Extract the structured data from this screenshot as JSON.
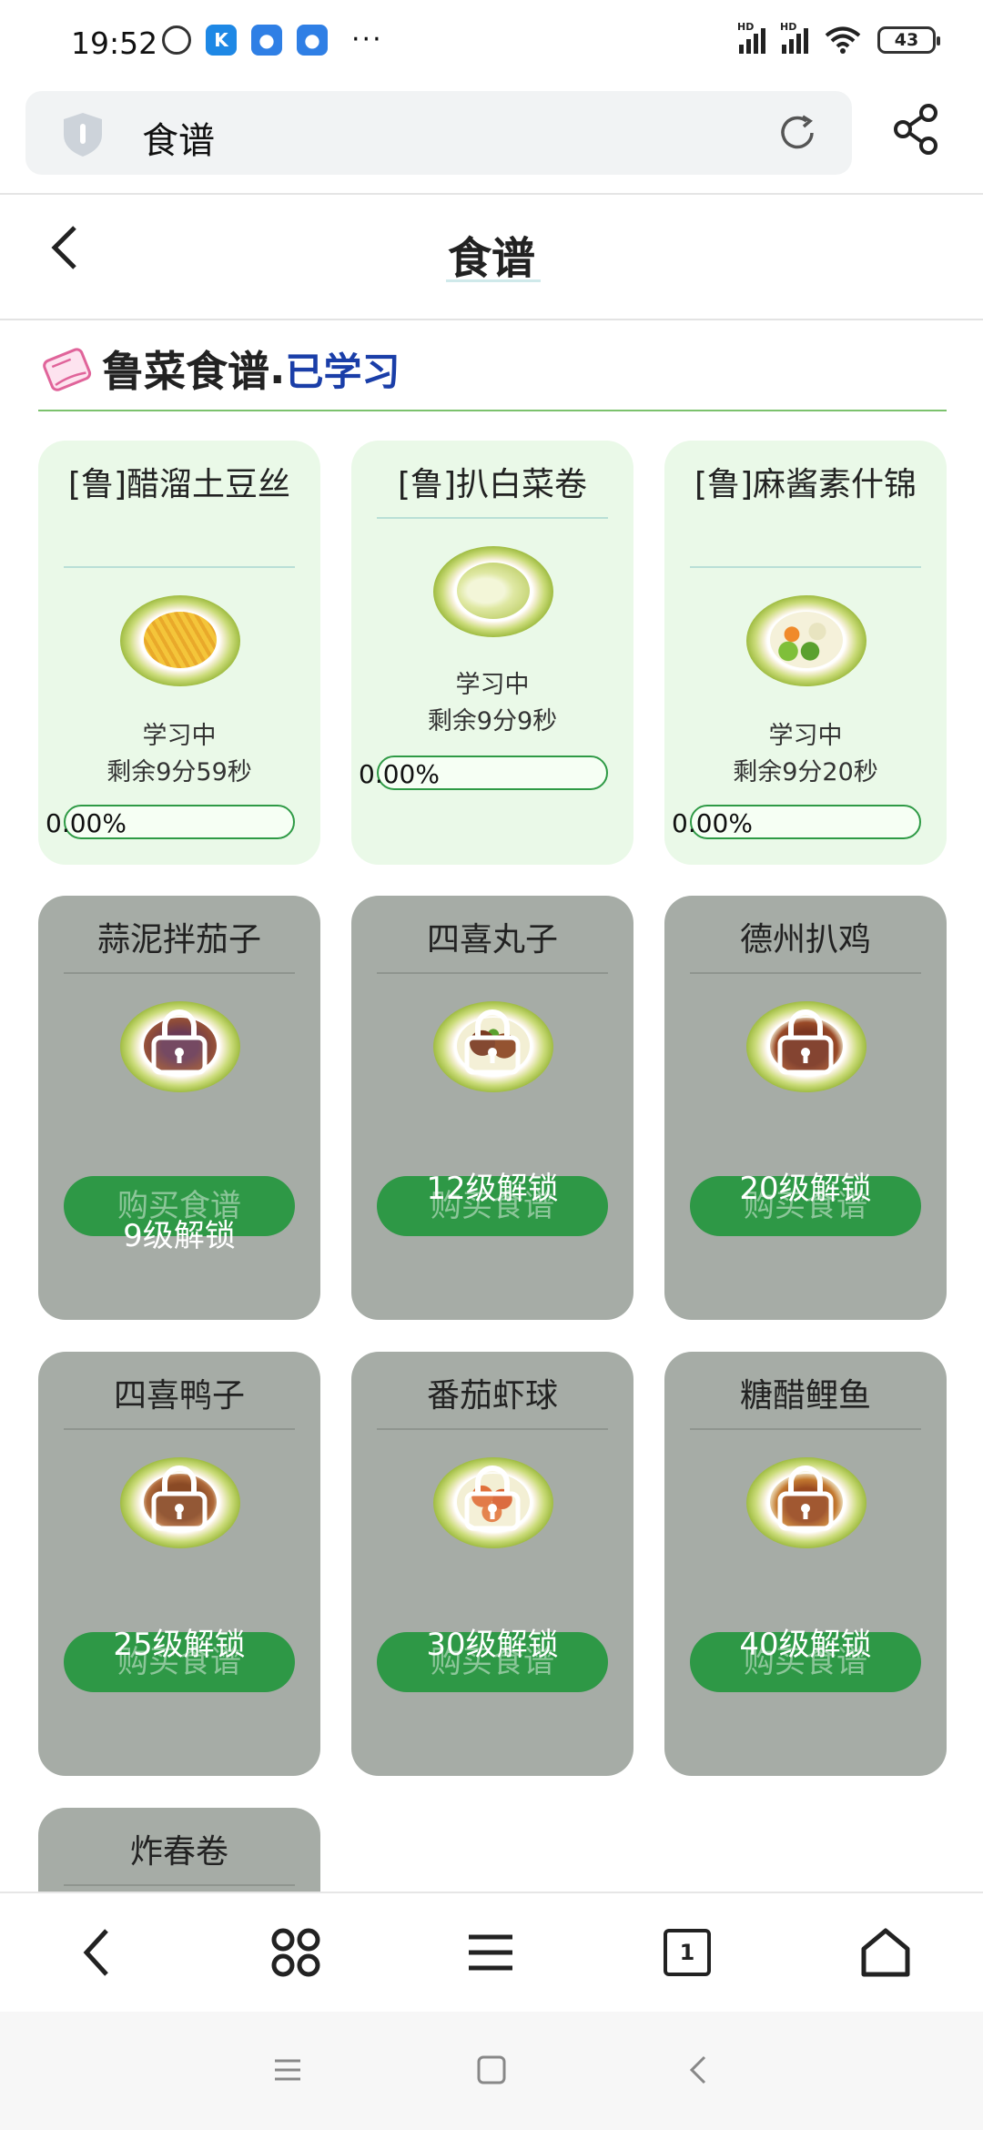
{
  "status_bar": {
    "time": "19:52",
    "battery": "43",
    "left_icons": [
      "alarm-icon",
      "k-app-icon",
      "qq-icon",
      "qq-icon"
    ],
    "more": "···",
    "signal_labels": [
      "HD",
      "HD"
    ]
  },
  "browser": {
    "address": "食谱"
  },
  "header": {
    "title": "食谱"
  },
  "section": {
    "name": "鲁菜食谱",
    "dot": ".",
    "status": "已学习"
  },
  "learning_cards": [
    {
      "title": "[鲁]醋溜土豆丝",
      "status": "学习中",
      "remaining": "剩余9分59秒",
      "progress_text": "0.00%",
      "progress": 0
    },
    {
      "title": "[鲁]扒白菜卷",
      "status": "学习中",
      "remaining": "剩余9分9秒",
      "progress_text": "0.00%",
      "progress": 0
    },
    {
      "title": "[鲁]麻酱素什锦",
      "status": "学习中",
      "remaining": "剩余9分20秒",
      "progress_text": "0.00%",
      "progress": 0
    }
  ],
  "locked_cards": [
    {
      "title": "蒜泥拌茄子",
      "button": "购买食谱",
      "unlock": "9级解锁"
    },
    {
      "title": "四喜丸子",
      "button": "购买食谱",
      "unlock": "12级解锁"
    },
    {
      "title": "德州扒鸡",
      "button": "购买食谱",
      "unlock": "20级解锁"
    },
    {
      "title": "四喜鸭子",
      "button": "购买食谱",
      "unlock": "25级解锁"
    },
    {
      "title": "番茄虾球",
      "button": "购买食谱",
      "unlock": "30级解锁"
    },
    {
      "title": "糖醋鲤鱼",
      "button": "购买食谱",
      "unlock": "40级解锁"
    },
    {
      "title": "炸春卷"
    }
  ],
  "bottom_nav": {
    "tab_count": "1",
    "items": [
      "back-icon",
      "menu-grid-icon",
      "list-icon",
      "tabs-icon",
      "home-icon"
    ]
  },
  "colors": {
    "learning_card": "#eaf9e8",
    "locked_card": "#a6aca6",
    "accent_green": "#2e9846",
    "section_status": "#1a3ea8"
  }
}
